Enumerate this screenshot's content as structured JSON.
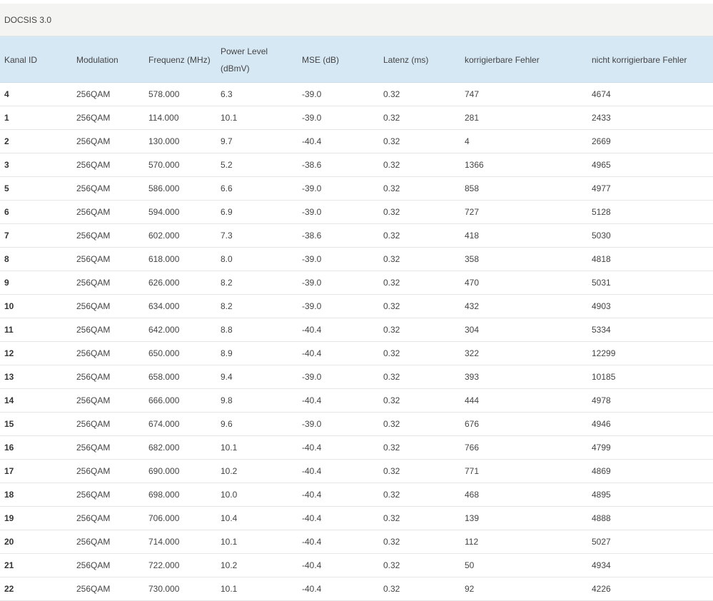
{
  "section": {
    "title": "DOCSIS 3.0"
  },
  "table": {
    "headers": {
      "kanal_id": "Kanal ID",
      "modulation": "Modulation",
      "frequenz": "Frequenz (MHz)",
      "power_line1": "Power Level",
      "power_line2": "(dBmV)",
      "mse": "MSE (dB)",
      "latenz": "Latenz (ms)",
      "korrigierbar": "korrigierbare Fehler",
      "nicht_korrigierbar": "nicht korrigierbare Fehler"
    },
    "rows": [
      [
        "4",
        "256QAM",
        "578.000",
        "6.3",
        "-39.0",
        "0.32",
        "747",
        "4674"
      ],
      [
        "1",
        "256QAM",
        "114.000",
        "10.1",
        "-39.0",
        "0.32",
        "281",
        "2433"
      ],
      [
        "2",
        "256QAM",
        "130.000",
        "9.7",
        "-40.4",
        "0.32",
        "4",
        "2669"
      ],
      [
        "3",
        "256QAM",
        "570.000",
        "5.2",
        "-38.6",
        "0.32",
        "1366",
        "4965"
      ],
      [
        "5",
        "256QAM",
        "586.000",
        "6.6",
        "-39.0",
        "0.32",
        "858",
        "4977"
      ],
      [
        "6",
        "256QAM",
        "594.000",
        "6.9",
        "-39.0",
        "0.32",
        "727",
        "5128"
      ],
      [
        "7",
        "256QAM",
        "602.000",
        "7.3",
        "-38.6",
        "0.32",
        "418",
        "5030"
      ],
      [
        "8",
        "256QAM",
        "618.000",
        "8.0",
        "-39.0",
        "0.32",
        "358",
        "4818"
      ],
      [
        "9",
        "256QAM",
        "626.000",
        "8.2",
        "-39.0",
        "0.32",
        "470",
        "5031"
      ],
      [
        "10",
        "256QAM",
        "634.000",
        "8.2",
        "-39.0",
        "0.32",
        "432",
        "4903"
      ],
      [
        "11",
        "256QAM",
        "642.000",
        "8.8",
        "-40.4",
        "0.32",
        "304",
        "5334"
      ],
      [
        "12",
        "256QAM",
        "650.000",
        "8.9",
        "-40.4",
        "0.32",
        "322",
        "12299"
      ],
      [
        "13",
        "256QAM",
        "658.000",
        "9.4",
        "-39.0",
        "0.32",
        "393",
        "10185"
      ],
      [
        "14",
        "256QAM",
        "666.000",
        "9.8",
        "-40.4",
        "0.32",
        "444",
        "4978"
      ],
      [
        "15",
        "256QAM",
        "674.000",
        "9.6",
        "-39.0",
        "0.32",
        "676",
        "4946"
      ],
      [
        "16",
        "256QAM",
        "682.000",
        "10.1",
        "-40.4",
        "0.32",
        "766",
        "4799"
      ],
      [
        "17",
        "256QAM",
        "690.000",
        "10.2",
        "-40.4",
        "0.32",
        "771",
        "4869"
      ],
      [
        "18",
        "256QAM",
        "698.000",
        "10.0",
        "-40.4",
        "0.32",
        "468",
        "4895"
      ],
      [
        "19",
        "256QAM",
        "706.000",
        "10.4",
        "-40.4",
        "0.32",
        "139",
        "4888"
      ],
      [
        "20",
        "256QAM",
        "714.000",
        "10.1",
        "-40.4",
        "0.32",
        "112",
        "5027"
      ],
      [
        "21",
        "256QAM",
        "722.000",
        "10.2",
        "-40.4",
        "0.32",
        "50",
        "4934"
      ],
      [
        "22",
        "256QAM",
        "730.000",
        "10.1",
        "-40.4",
        "0.32",
        "92",
        "4226"
      ]
    ]
  }
}
